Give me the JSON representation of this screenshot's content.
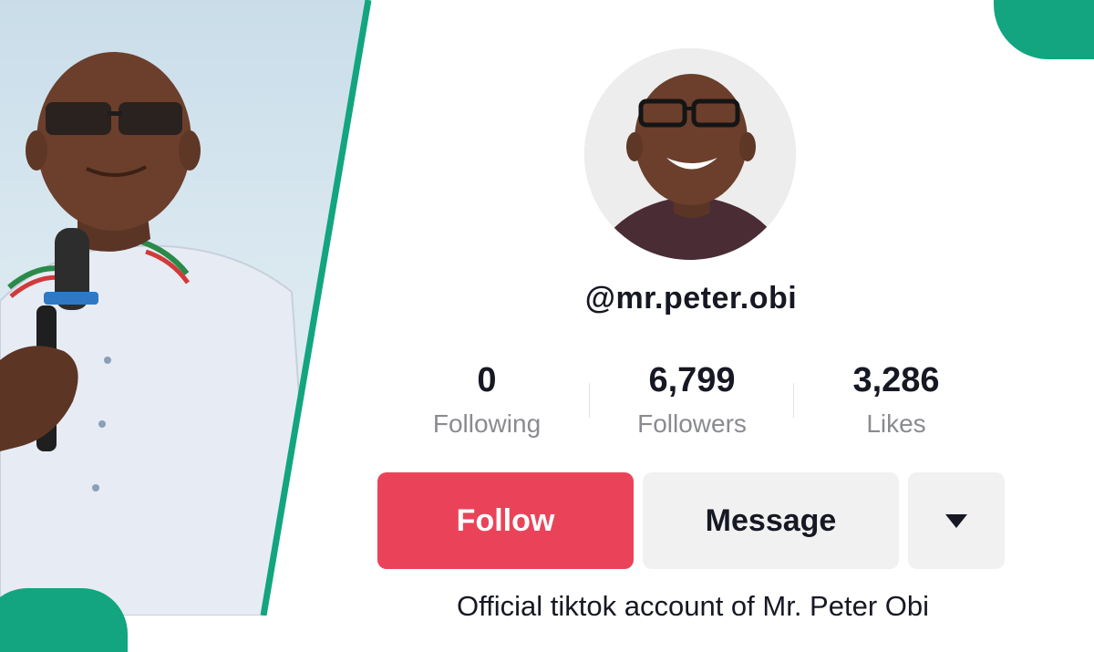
{
  "profile": {
    "username": "@mr.peter.obi",
    "bio": "Official tiktok account of Mr. Peter Obi"
  },
  "stats": [
    {
      "value": "0",
      "label": "Following"
    },
    {
      "value": "6,799",
      "label": "Followers"
    },
    {
      "value": "3,286",
      "label": "Likes"
    }
  ],
  "actions": {
    "follow_label": "Follow",
    "message_label": "Message",
    "more_icon": "caret-down-icon"
  },
  "colors": {
    "accent_green": "#12a57f",
    "follow_red": "#ea4359",
    "secondary_bg": "#f1f1f2",
    "text_primary": "#161823",
    "text_muted": "#8a8b91"
  }
}
